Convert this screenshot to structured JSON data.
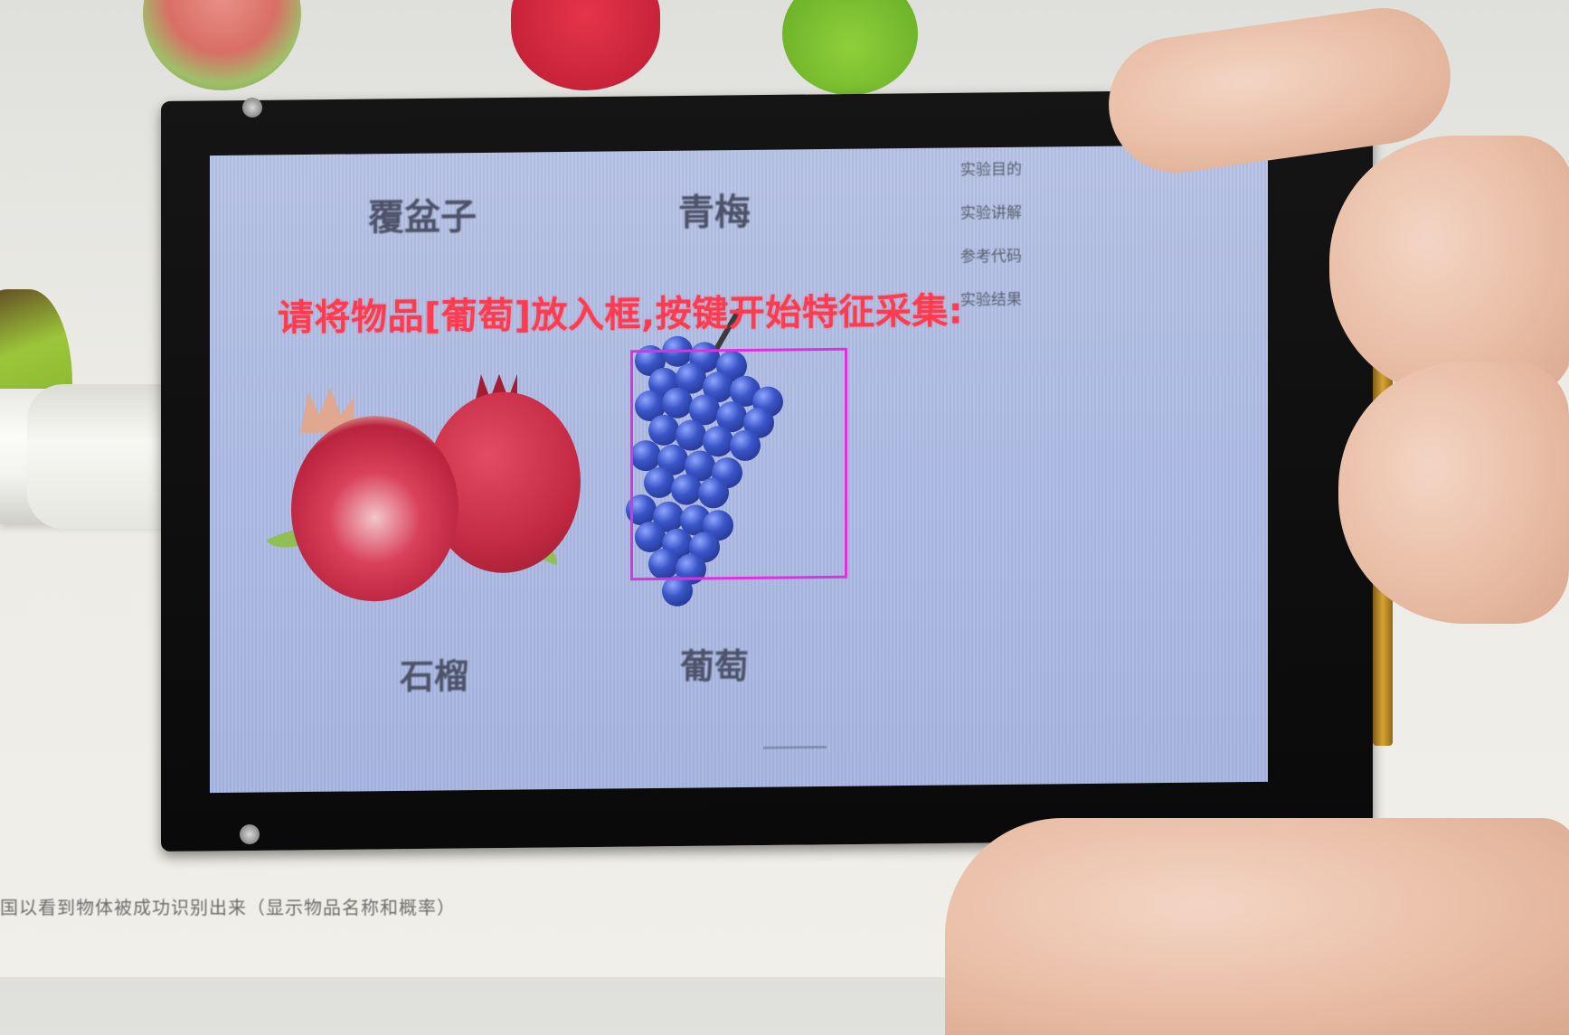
{
  "background_page": {
    "caption": "国以看到物体被成功识别出来（显示物品名称和概率）"
  },
  "screen": {
    "labels": {
      "raspberry": "覆盆子",
      "green_plum": "青梅",
      "pomegranate": "石榴",
      "grape": "葡萄"
    },
    "sidebar_items": [
      "实验目的",
      "实验讲解",
      "参考代码",
      "实验结果"
    ],
    "prompt": "请将物品[葡萄]放入框,按键开始特征采集:",
    "detection_box_color": "#e030e0",
    "prompt_color": "#ff3b4f"
  }
}
